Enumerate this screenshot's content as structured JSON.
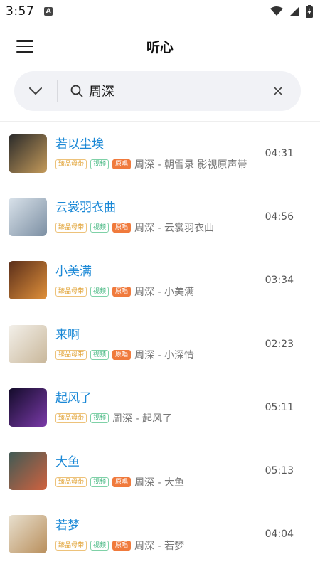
{
  "status": {
    "time": "3:57",
    "notif": "A"
  },
  "header": {
    "title": "听心"
  },
  "search": {
    "value": "周深"
  },
  "tags": {
    "master": "臻品母带",
    "video": "视频",
    "original": "原唱"
  },
  "songs": [
    {
      "title": "若以尘埃",
      "subtitle": "周深 - 朝雪录 影视原声带",
      "duration": "04:31",
      "original": true,
      "cover": [
        "#2a2a2a",
        "#c49a5a"
      ]
    },
    {
      "title": "云裳羽衣曲",
      "subtitle": "周深 - 云裳羽衣曲",
      "duration": "04:56",
      "original": true,
      "cover": [
        "#d9e2ea",
        "#7c8fa3"
      ]
    },
    {
      "title": "小美满",
      "subtitle": "周深 - 小美满",
      "duration": "03:34",
      "original": true,
      "cover": [
        "#5a2e1a",
        "#e0903a"
      ]
    },
    {
      "title": "来啊",
      "subtitle": "周深 - 小深情",
      "duration": "02:23",
      "original": true,
      "cover": [
        "#f3f0ea",
        "#c9b79a"
      ]
    },
    {
      "title": "起风了",
      "subtitle": "周深 - 起风了",
      "duration": "05:11",
      "original": false,
      "cover": [
        "#130b2a",
        "#7a3aa8"
      ]
    },
    {
      "title": "大鱼",
      "subtitle": "周深 - 大鱼",
      "duration": "05:13",
      "original": true,
      "cover": [
        "#3f5a55",
        "#d0623f"
      ]
    },
    {
      "title": "若梦",
      "subtitle": "周深 - 若梦",
      "duration": "04:04",
      "original": true,
      "cover": [
        "#e8e0cf",
        "#b98f5c"
      ]
    }
  ]
}
